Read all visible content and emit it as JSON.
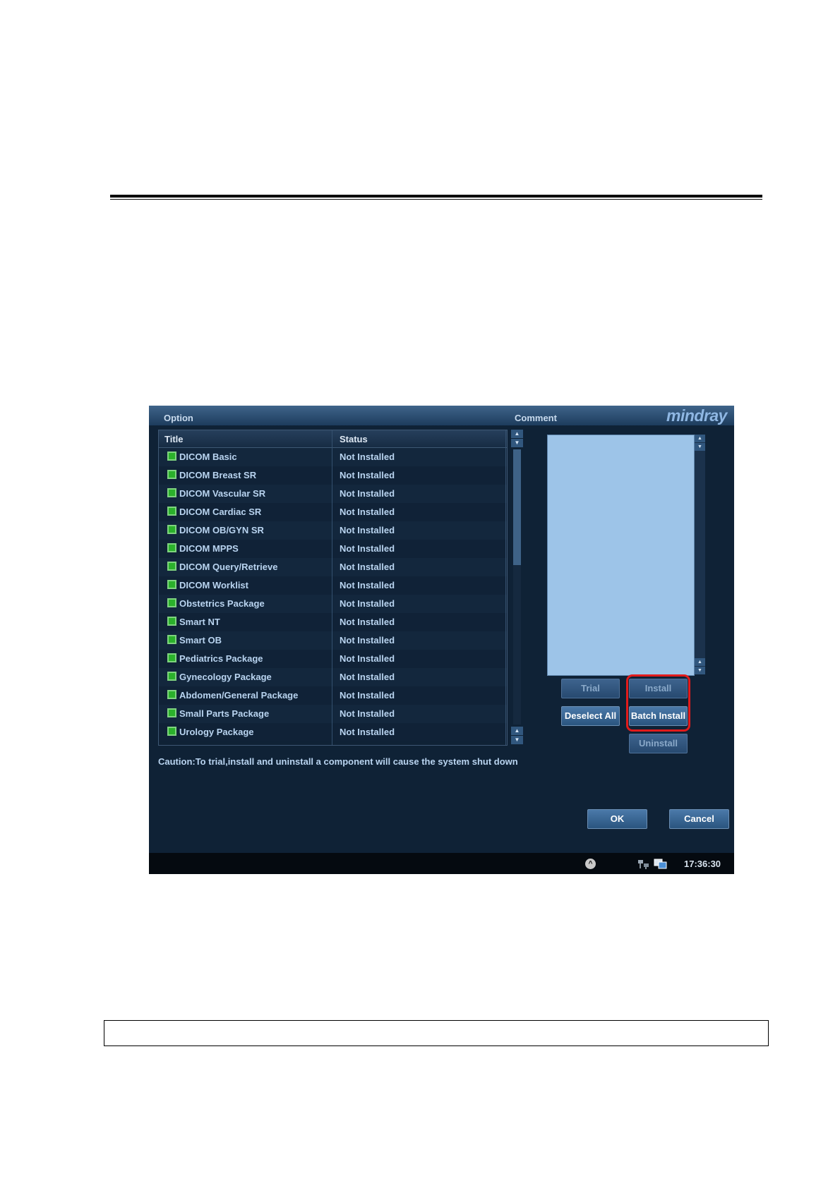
{
  "dialog": {
    "option_label": "Option",
    "comment_label": "Comment",
    "logo_text": "mindray"
  },
  "table": {
    "columns": [
      "Title",
      "Status"
    ],
    "rows": [
      {
        "title": "DICOM Basic",
        "status": "Not Installed"
      },
      {
        "title": "DICOM Breast SR",
        "status": "Not Installed"
      },
      {
        "title": "DICOM Vascular SR",
        "status": "Not Installed"
      },
      {
        "title": "DICOM Cardiac SR",
        "status": "Not Installed"
      },
      {
        "title": "DICOM OB/GYN SR",
        "status": "Not Installed"
      },
      {
        "title": "DICOM MPPS",
        "status": "Not Installed"
      },
      {
        "title": "DICOM Query/Retrieve",
        "status": "Not Installed"
      },
      {
        "title": "DICOM Worklist",
        "status": "Not Installed"
      },
      {
        "title": "Obstetrics Package",
        "status": "Not Installed"
      },
      {
        "title": "Smart NT",
        "status": "Not Installed"
      },
      {
        "title": "Smart OB",
        "status": "Not Installed"
      },
      {
        "title": "Pediatrics Package",
        "status": "Not Installed"
      },
      {
        "title": "Gynecology Package",
        "status": "Not Installed"
      },
      {
        "title": "Abdomen/General Package",
        "status": "Not Installed"
      },
      {
        "title": "Small Parts Package",
        "status": "Not Installed"
      },
      {
        "title": "Urology Package",
        "status": "Not Installed"
      }
    ]
  },
  "buttons": {
    "trial": "Trial",
    "install": "Install",
    "deselect_all": "Deselect All",
    "batch_install": "Batch Install",
    "uninstall": "Uninstall",
    "ok": "OK",
    "cancel": "Cancel"
  },
  "caution": "Caution:To trial,install and uninstall a component will cause the system shut down",
  "statusbar": {
    "time": "17:36:30"
  },
  "icons": [
    "up-arrow-icon",
    "network-icon",
    "monitor-icon",
    "checkbox-icon"
  ],
  "colors": {
    "highlight": "#e21b1b",
    "background": "#0f2236",
    "accent": "#4b79a9"
  }
}
